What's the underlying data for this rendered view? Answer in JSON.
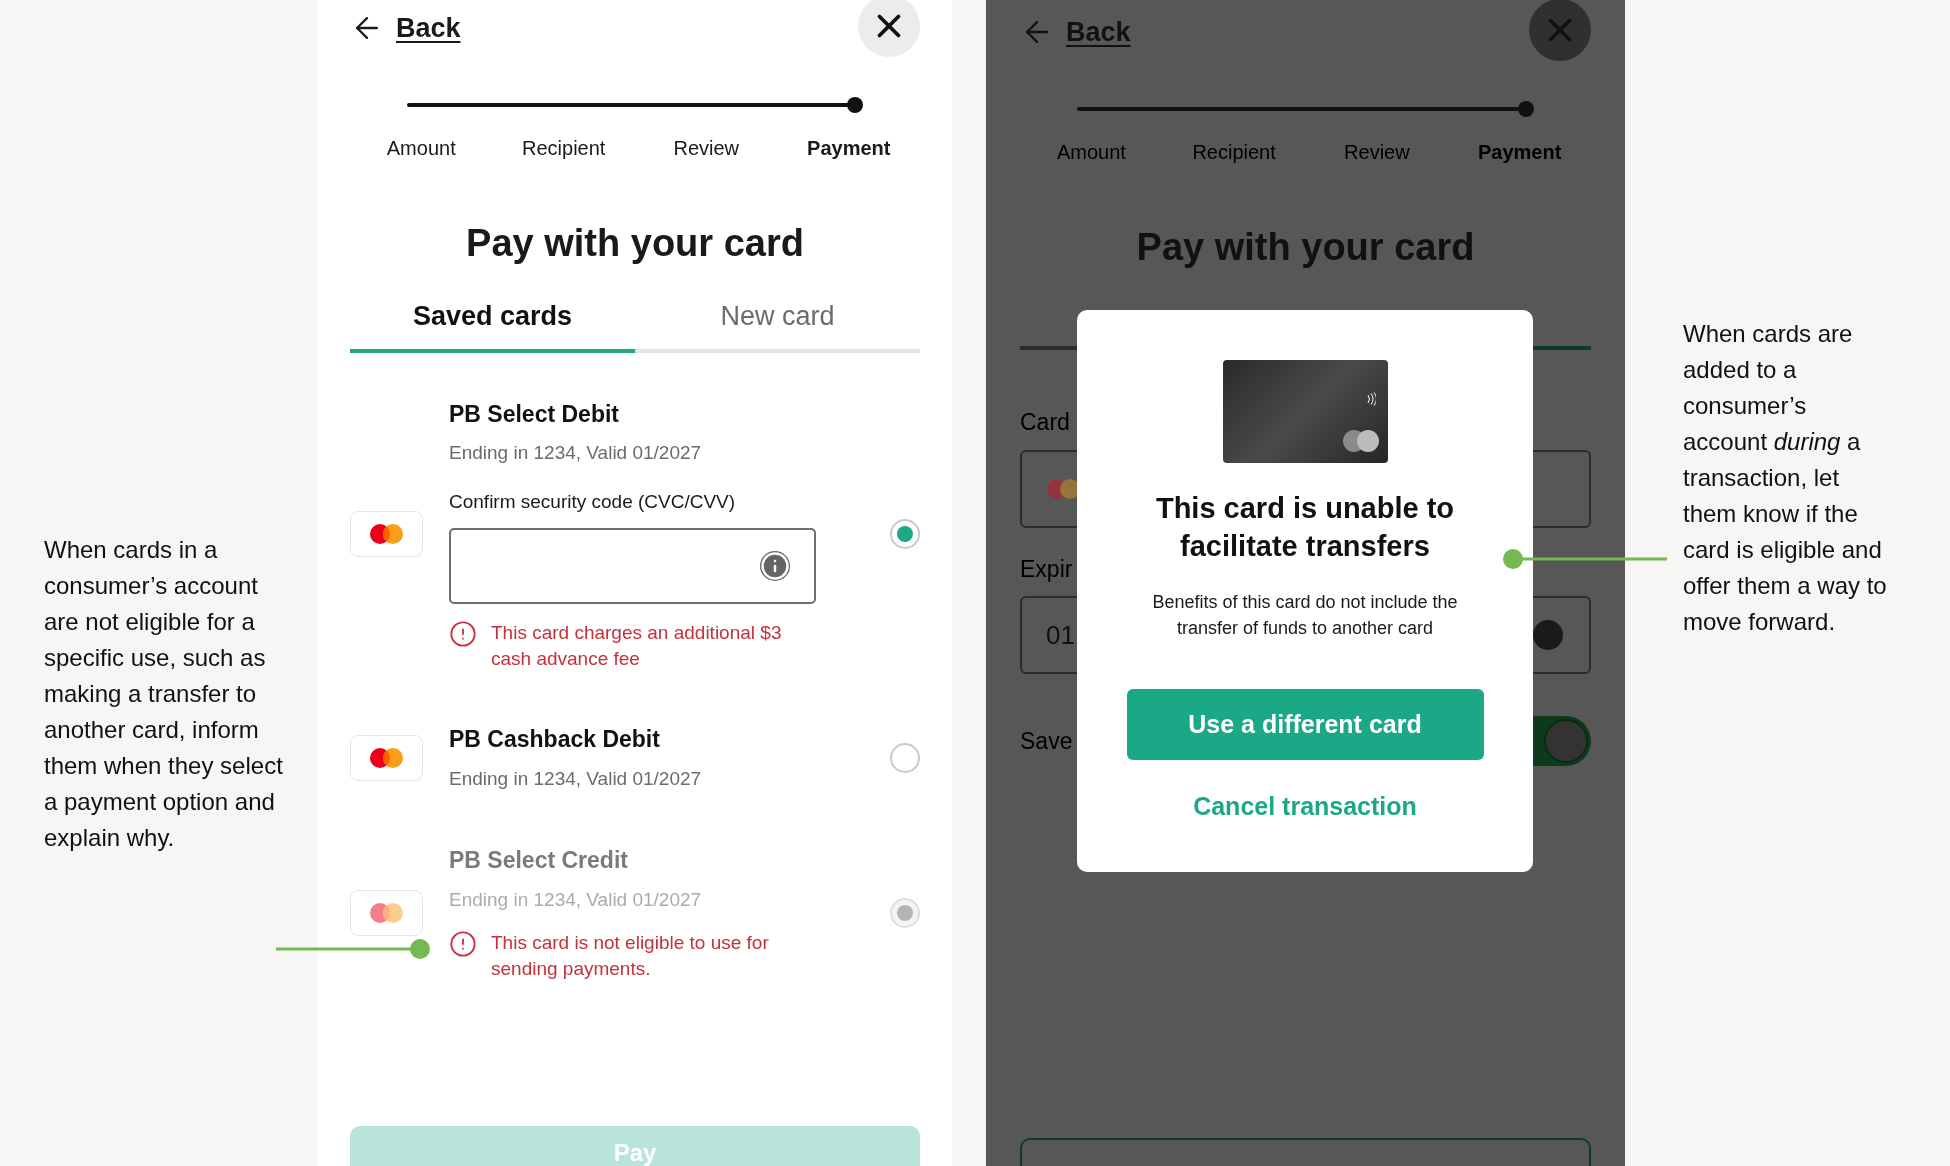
{
  "annotations": [
    {
      "text": "When cards in a consumer’s account are not eligible for a specific use, such as making a transfer to another card, inform them when they select a payment option and explain why."
    },
    {
      "text": "When cards are added to a consumer’s account *during* a transaction, let them know if the card is eligible and offer them a way to move forward."
    }
  ],
  "left_screen": {
    "back": "Back",
    "steps": [
      {
        "label": "Amount",
        "selected": false
      },
      {
        "label": "Recipient",
        "selected": false
      },
      {
        "label": "Review",
        "selected": false
      },
      {
        "label": "Payment",
        "selected": true
      }
    ],
    "title": "Pay with your card",
    "tabs": [
      {
        "label": "Saved cards",
        "selected": true
      },
      {
        "label": "New card",
        "selected": false
      }
    ],
    "cards": [
      {
        "name": "PB Select Debit",
        "detail": "Ending in 1234, Valid 01/2027",
        "selected": true,
        "disabled": false,
        "security_label": "Confirm security code (CVC/CVV)",
        "warning": "This card charges an additional $3 cash advance fee"
      },
      {
        "name": "PB Cashback Debit",
        "detail": "Ending in 1234, Valid 01/2027",
        "selected": false,
        "disabled": false
      },
      {
        "name": "PB Select Credit",
        "detail": "Ending in 1234, Valid 01/2027",
        "selected": true,
        "disabled": true,
        "warning": "This card is not eligible to use for sending payments."
      }
    ],
    "pay_button": {
      "label": "Pay",
      "disabled": true
    }
  },
  "right_screen": {
    "back": "Back",
    "steps": [
      {
        "label": "Amount",
        "selected": false
      },
      {
        "label": "Recipient",
        "selected": false
      },
      {
        "label": "Review",
        "selected": false
      },
      {
        "label": "Payment",
        "selected": true
      }
    ],
    "title": "Pay with your card",
    "card_label": "Card",
    "expiry_label": "Expir",
    "expiry_value": "01",
    "save_label": "Save",
    "save_toggle": {
      "on": true
    },
    "modal": {
      "heading": "This card is unable to facilitate transfers",
      "body": "Benefits of this card do not include the transfer of funds to another card",
      "primary_button": "Use a different card",
      "secondary_button": "Cancel transaction"
    }
  }
}
